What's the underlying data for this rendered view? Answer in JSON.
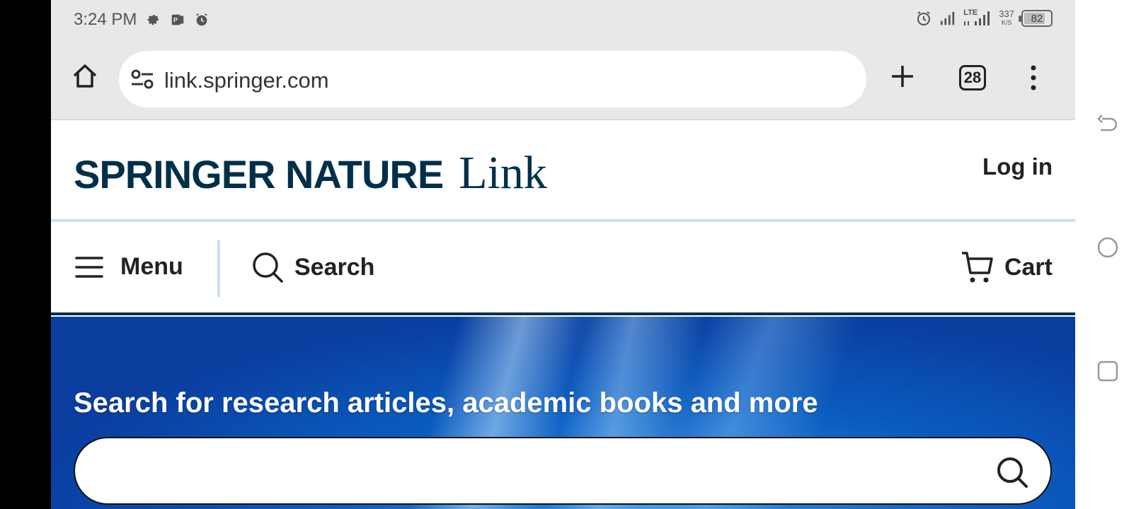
{
  "status_bar": {
    "time": "3:24 PM",
    "network_type": "LTE",
    "net_speed_value": "337",
    "net_speed_unit": "K/S",
    "battery_percent": "82"
  },
  "browser": {
    "url": "link.springer.com",
    "tab_count": "28"
  },
  "site": {
    "logo_brand": "SPRINGER NATURE",
    "logo_product": "Link",
    "login_label": "Log in",
    "nav": {
      "menu_label": "Menu",
      "search_label": "Search",
      "cart_label": "Cart"
    },
    "hero": {
      "title": "Search for research articles, academic books and more",
      "search_value": ""
    }
  },
  "colors": {
    "brand_dark": "#003049",
    "accent_light": "#c8e1f4",
    "hero_blue": "#0a5cc0"
  }
}
